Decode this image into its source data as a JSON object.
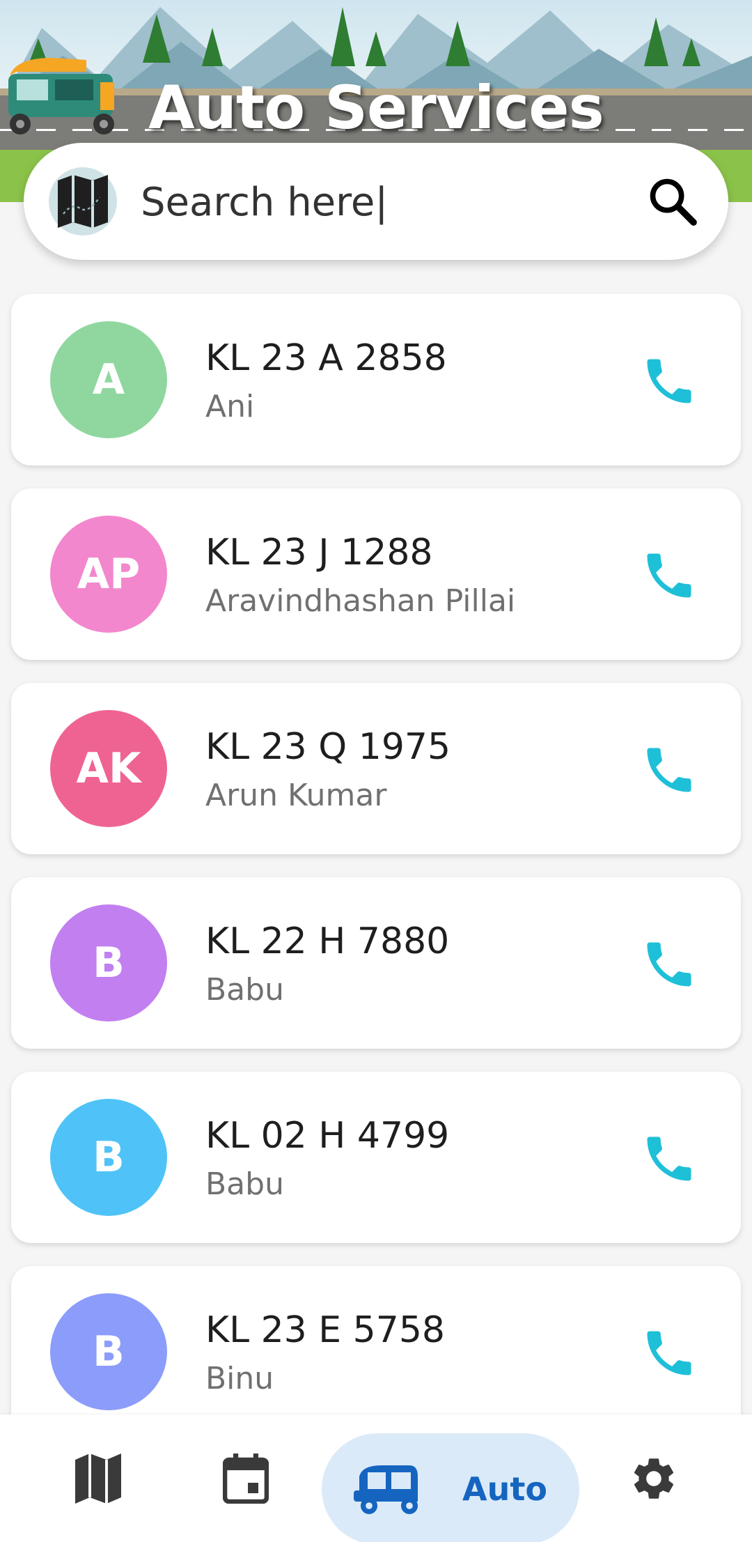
{
  "header": {
    "title": "Auto Services"
  },
  "search": {
    "placeholder": "Search here|",
    "value": "",
    "map_icon": "map-icon",
    "search_icon": "search-icon"
  },
  "drivers": [
    {
      "initials": "A",
      "plate": "KL 23 A 2858",
      "name": "Ani",
      "color": "#8fd79f"
    },
    {
      "initials": "AP",
      "plate": "KL 23 J 1288",
      "name": "Aravindhashan Pillai",
      "color": "#f387cd"
    },
    {
      "initials": "AK",
      "plate": "KL 23 Q 1975",
      "name": "Arun Kumar",
      "color": "#ef6392"
    },
    {
      "initials": "B",
      "plate": "KL 22 H 7880",
      "name": "Babu",
      "color": "#c27ff0"
    },
    {
      "initials": "B",
      "plate": "KL 02 H 4799",
      "name": "Babu",
      "color": "#4fc3f7"
    },
    {
      "initials": "B",
      "plate": "KL 23 E 5758",
      "name": "Binu",
      "color": "#8c9cfb"
    }
  ],
  "colors": {
    "call_icon": "#1ec0d8",
    "nav_active": "#1565c0",
    "nav_active_bg": "#dbeaf8"
  },
  "bottom_nav": {
    "items": [
      {
        "icon": "map-icon"
      },
      {
        "icon": "calendar-icon"
      },
      {
        "icon": "auto-rickshaw-icon",
        "label": "Auto",
        "active": true
      },
      {
        "icon": "gear-icon"
      }
    ]
  }
}
